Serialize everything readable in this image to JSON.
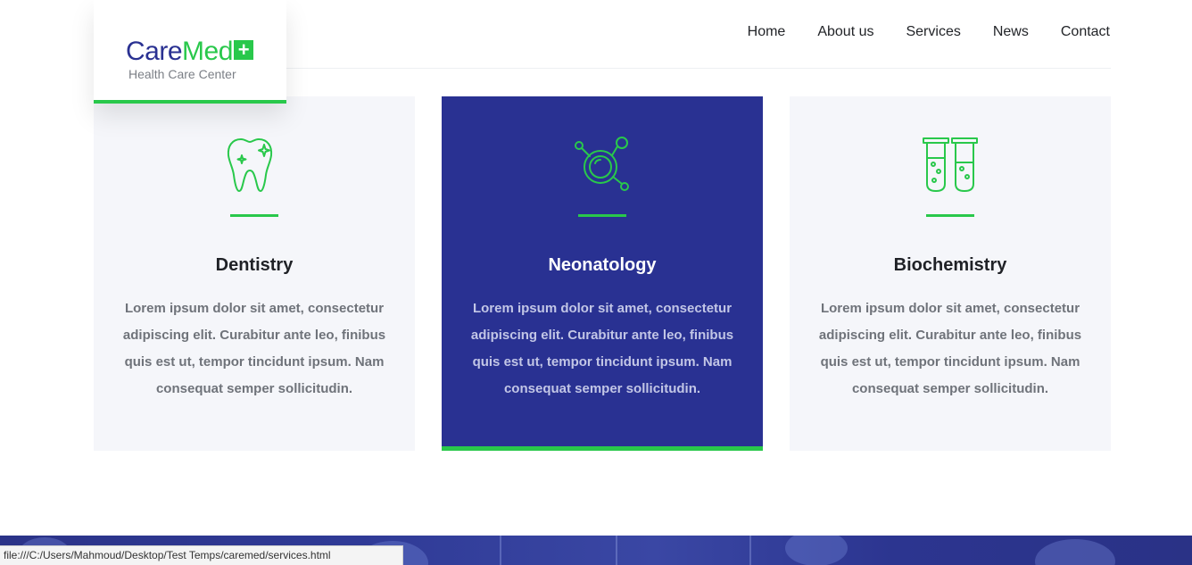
{
  "colors": {
    "brand_blue": "#2a3192",
    "brand_green": "#29c84b",
    "card_bg": "#f5f6fa",
    "card_active_bg": "#293192"
  },
  "logo": {
    "care": "CareMed",
    "plus": "+",
    "subtitle": "Health Care Center"
  },
  "nav": {
    "items": [
      {
        "label": "Home"
      },
      {
        "label": "About us"
      },
      {
        "label": "Services"
      },
      {
        "label": "News"
      },
      {
        "label": "Contact"
      }
    ]
  },
  "cards": [
    {
      "icon": "tooth-icon",
      "title": "Dentistry",
      "text": "Lorem ipsum dolor sit amet, consectetur adipiscing elit. Curabitur ante leo, finibus quis est ut, tempor tincidunt ipsum. Nam consequat semper sollicitudin."
    },
    {
      "icon": "molecule-magnifier-icon",
      "title": "Neonatology",
      "text": "Lorem ipsum dolor sit amet, consectetur adipiscing elit. Curabitur ante leo, finibus quis est ut, tempor tincidunt ipsum. Nam consequat semper sollicitudin."
    },
    {
      "icon": "test-tubes-icon",
      "title": "Biochemistry",
      "text": "Lorem ipsum dolor sit amet, consectetur adipiscing elit. Curabitur ante leo, finibus quis est ut, tempor tincidunt ipsum. Nam consequat semper sollicitudin."
    }
  ],
  "status_bar": {
    "url": "file:///C:/Users/Mahmoud/Desktop/Test Temps/caremed/services.html"
  }
}
